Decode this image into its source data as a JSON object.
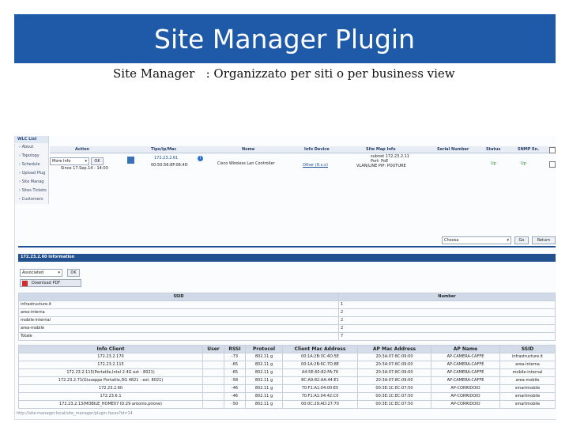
{
  "slide": {
    "title": "Site Manager Plugin",
    "subtitle": "Site Manager   : Organizzato per siti o per business view"
  },
  "sidebar": {
    "header": "WLC List",
    "items": [
      "About",
      "Topology",
      "Schedule",
      "Upload Plug",
      "Site Manag",
      "Sites Tickets",
      "Customers"
    ]
  },
  "device_grid": {
    "columns": [
      "Action",
      "Tipo/ip/Mac",
      "Nome",
      "Info Device",
      "Site Map Info",
      "Serial Number",
      "Status",
      "SNMP En."
    ],
    "row": {
      "action_select": "More Info",
      "action_button": "OK",
      "since_text": "Since 17.Sep.14 - 14:03",
      "ip": "172.23.2.61",
      "mac": "00:50:56:8F:06:4D",
      "name": "Cisco Wireless Lan Controller",
      "info": "Other (8.x.x)",
      "site_map_line1": "subnet 172.23.2.11",
      "site_map_line2": "Port: PoE",
      "site_map_line3": "VLAN/LINE PIP: POUTURE",
      "status": "Up",
      "snmp": "Up"
    }
  },
  "toolbar2": {
    "select": "Choosa",
    "go_button": "Go",
    "return_button": "Return"
  },
  "info_panel": {
    "title": "172.23.2.60 information",
    "select": "Associated",
    "ok_button": "OK",
    "download_label": "Download PDF"
  },
  "ssid_table": {
    "headers": [
      "SSID",
      "Number"
    ],
    "rows": [
      [
        "infrastructure.it",
        "1"
      ],
      [
        "area-interna",
        "2"
      ],
      [
        "mobile-internal",
        "2"
      ],
      [
        "area-mobile",
        "2"
      ],
      [
        "Totale",
        "7"
      ]
    ]
  },
  "client_table": {
    "headers": [
      "Info Client",
      "User",
      "RSSI",
      "Protocol",
      "Client Mac Address",
      "AP Mac Address",
      "AP Name",
      "SSID"
    ],
    "rows": [
      [
        "172.23.2.170",
        "",
        "-73",
        "802.11 g",
        "00:1A:2B:3C:4D:5E",
        "20:3A:07:8C:09:00",
        "AP-CAMERA-CAFFE",
        "infrastructure.it"
      ],
      [
        "172.23.2.115",
        "",
        "-65",
        "802.11 g",
        "00:1A:2B:6C:7D:8E",
        "20:3A:07:8C:09:00",
        "AP-CAMERA-CAFFE",
        "area-interna"
      ],
      [
        "172.23.2.115(Portatile,Intel 2.4G ext - 8021)",
        "",
        "-65",
        "802.11 g",
        "A4:5E:60:82:FA:76",
        "20:3A:07:8C:09:00",
        "AP-CAMERA-CAFFE",
        "mobile-internal"
      ],
      [
        "172.23.2.71(Giuseppe Portatile,DG 4821 - ext. 8021)",
        "",
        "-58",
        "802.11 g",
        "8C:A9:82:AA:44:E1",
        "20:3A:07:8C:09:00",
        "AP-CAMERA-CAFFE",
        "area-mobile"
      ],
      [
        "172.23.2.60",
        "",
        "-46",
        "802.11 g",
        "70:F1:A1:04:00:E5",
        "00:3E:1C:EC:07:50",
        "AP-CORRIDOIO",
        "smartmobile"
      ],
      [
        "172.23.6.1",
        "",
        "-46",
        "802.11 g",
        "70:F1:A1:04:42:C0",
        "00:3E:1C:EC:07:50",
        "AP-CORRIDOIO",
        "smartmobile"
      ],
      [
        "172.23.2.13(MOBILE_HOME07 ID:29 antonio.pirone)",
        "",
        "-50",
        "802.11 g",
        "00:0C:29:AD:27:70",
        "00:3E:1C:EC:07:50",
        "AP-CORRIDOIO",
        "smartmobile"
      ]
    ]
  },
  "footer_text": "http://site-manager.local/site_manager/plugin.faces?id=14",
  "colors": {
    "banner": "#1f5aa8",
    "header_bar": "#23508f",
    "status_up": "#2b8a2b"
  }
}
